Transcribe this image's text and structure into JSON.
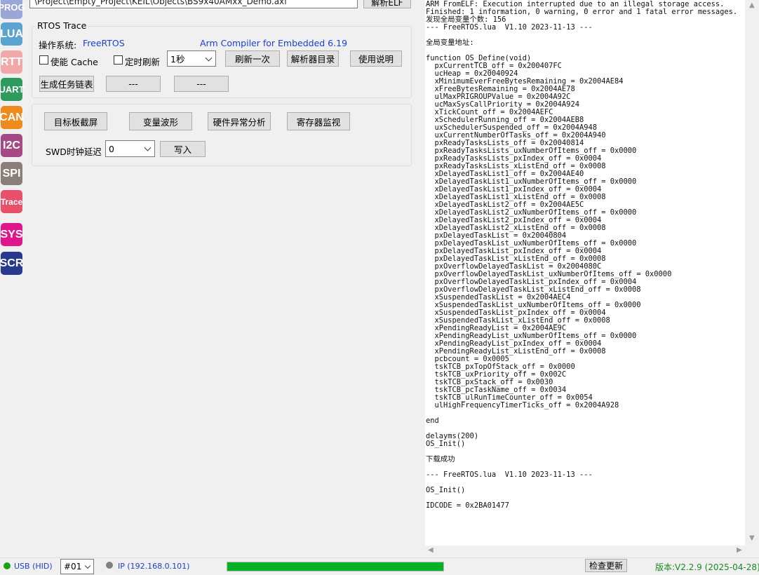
{
  "sidebar": {
    "tools": [
      {
        "label": "PROG",
        "color": "#9aa6d6"
      },
      {
        "label": "LUA",
        "color": "#5aa4cf"
      },
      {
        "label": "RTT",
        "color": "#f2a8a8"
      },
      {
        "label": "UART",
        "color": "#2e9a5e"
      },
      {
        "label": "CAN",
        "color": "#f08a1c"
      },
      {
        "label": "I2C",
        "color": "#a64a86"
      },
      {
        "label": "SPI",
        "color": "#8a7f78"
      },
      {
        "label": "Trace",
        "color": "#e84f6a"
      },
      {
        "label": "SYS",
        "color": "#e0168c"
      },
      {
        "label": "SCR",
        "color": "#283a8e"
      }
    ]
  },
  "elf": {
    "path": "\\Project\\Empty_Project\\KEIL\\Objects\\BS9x40AMxx_Demo.axf",
    "parse_button": "解析ELF"
  },
  "rtos": {
    "title": "RTOS Trace",
    "os_label": "操作系统:",
    "os_value": "FreeRTOS",
    "compiler": "Arm Compiler for Embedded 6.19",
    "enable_cache": "使能 Cache",
    "timed_refresh": "定时刷新",
    "interval": "1秒",
    "refresh_once": "刷新一次",
    "parser_dir": "解析器目录",
    "manual": "使用说明",
    "gen_task_list": "生成任务链表",
    "btn_blank1": "---",
    "btn_blank2": "---"
  },
  "tools2": {
    "screenshot": "目标板截屏",
    "waveform": "变量波形",
    "fault_analysis": "硬件异常分析",
    "register_monitor": "寄存器监视",
    "swd_delay_label": "SWD时钟延迟",
    "swd_delay_value": "0",
    "write": "写入"
  },
  "log": {
    "text": "ARM FromELF: Execution interrupted due to an illegal storage access.\nFinished: 1 information, 0 warning, 0 error and 1 fatal error messages.\n发现全局变量个数: 156\n--- FreeRTOS.lua  V1.10 2023-11-13 ---\n\n全局变量地址:\n\nfunction OS_Define(void)\n  pxCurrentTCB_off = 0x200407FC\n  ucHeap = 0x20040924\n  xMinimumEverFreeBytesRemaining = 0x2004AE84\n  xFreeBytesRemaining = 0x2004AE78\n  ulMaxPRIGROUPValue = 0x2004A92C\n  ucMaxSysCallPriority = 0x2004A924\n  xTickCount_off = 0x2004AEFC\n  xSchedulerRunning_off = 0x2004AEB8\n  uxSchedulerSuspended_off = 0x2004A948\n  uxCurrentNumberOfTasks_off = 0x2004A940\n  pxReadyTasksLists_off = 0x20040814\n  pxReadyTasksLists_uxNumberOfItems_off = 0x0000\n  pxReadyTasksLists_pxIndex_off = 0x0004\n  pxReadyTasksLists_xListEnd_off = 0x0008\n  xDelayedTaskList1_off = 0x2004AE40\n  xDelayedTaskList1_uxNumberOfItems_off = 0x0000\n  xDelayedTaskList1_pxIndex_off = 0x0004\n  xDelayedTaskList1_xListEnd_off = 0x0008\n  xDelayedTaskList2_off = 0x2004AE5C\n  xDelayedTaskList2_uxNumberOfItems_off = 0x0000\n  xDelayedTaskList2_pxIndex_off = 0x0004\n  xDelayedTaskList2_xListEnd_off = 0x0008\n  pxDelayedTaskList = 0x20040804\n  pxDelayedTaskList_uxNumberOfItems_off = 0x0000\n  pxDelayedTaskList_pxIndex_off = 0x0004\n  pxDelayedTaskList_xListEnd_off = 0x0008\n  pxOverflowDelayedTaskList = 0x2004080C\n  pxOverflowDelayedTaskList_uxNumberOfItems_off = 0x0000\n  pxOverflowDelayedTaskList_pxIndex_off = 0x0004\n  pxOverflowDelayedTaskList_xListEnd_off = 0x0008\n  xSuspendedTaskList = 0x2004AEC4\n  xSuspendedTaskList_uxNumberOfItems_off = 0x0000\n  xSuspendedTaskList_pxIndex_off = 0x0004\n  xSuspendedTaskList_xListEnd_off = 0x0008\n  xPendingReadyList = 0x2004AE9C\n  xPendingReadyList_uxNumberOfItems_off = 0x0000\n  xPendingReadyList_pxIndex_off = 0x0004\n  xPendingReadyList_xListEnd_off = 0x0008\n  pcbcount = 0x0005\n  tskTCB_pxTopOfStack_off = 0x0000\n  tskTCB_uxPriority_off = 0x002C\n  tskTCB_pxStack_off = 0x0030\n  tskTCB_pcTaskName_off = 0x0034\n  tskTCB_ulRunTimeCounter_off = 0x0054\n  ulHighFrequencyTimerTicks_off = 0x2004A928\n\nend\n\ndelayms(200)\nOS_Init()\n\n下载成功\n\n--- FreeRTOS.lua  V1.10 2023-11-13 ---\n\nOS_Init()\n\nIDCODE = 0x2BA01477"
  },
  "status": {
    "usb": "USB (HID)",
    "device_index": "#01",
    "ip": "IP (192.168.0.101)",
    "progress": 1.0,
    "check_update": "检查更新",
    "version": "版本:V2.2.9 (2025-04-28)",
    "usb_color": "#1aa31a",
    "ip_color": "#808080",
    "version_color": "#1c8a1c"
  }
}
